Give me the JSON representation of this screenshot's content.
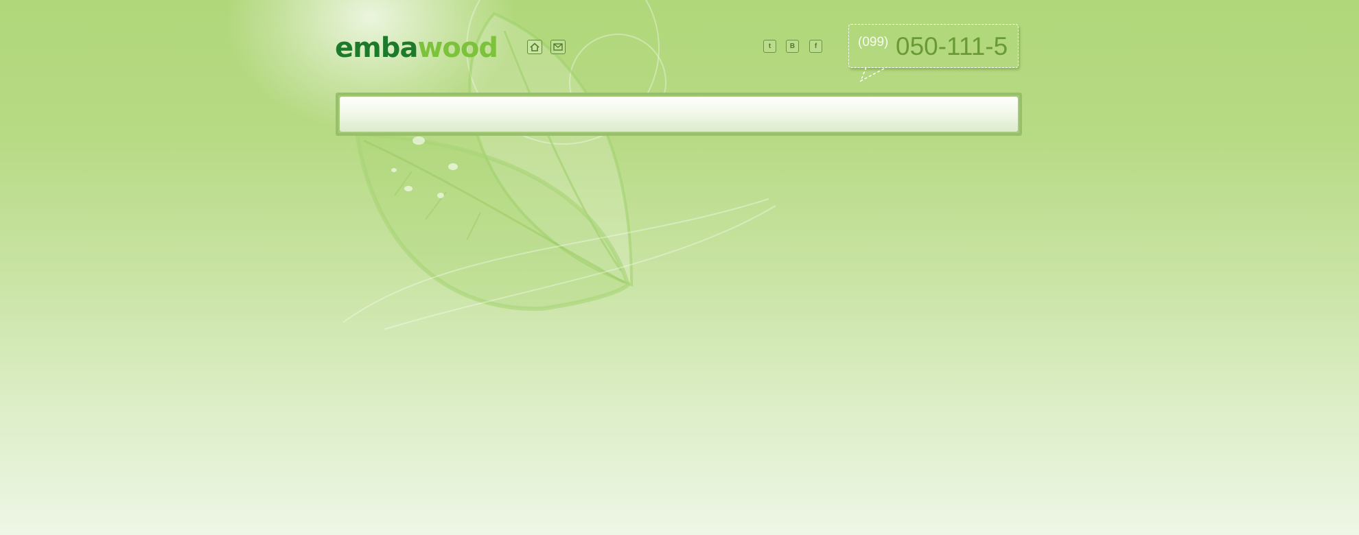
{
  "brand": {
    "part1": "emba",
    "part2": "wood"
  },
  "icons": {
    "home": "home-icon",
    "mail": "mail-icon",
    "twitter": "twitter-icon",
    "vkontakte": "vkontakte-icon",
    "facebook": "facebook-icon"
  },
  "social": {
    "twitter_glyph": "t",
    "vkontakte_glyph": "B",
    "facebook_glyph": "f"
  },
  "phone": {
    "code": "(099)",
    "number": "050-111-5"
  },
  "colors": {
    "brand_dark_green": "#1d7a2a",
    "brand_light_green": "#7cc23a",
    "background_green": "#b0d77a",
    "phone_number_green": "#6a9a36"
  }
}
